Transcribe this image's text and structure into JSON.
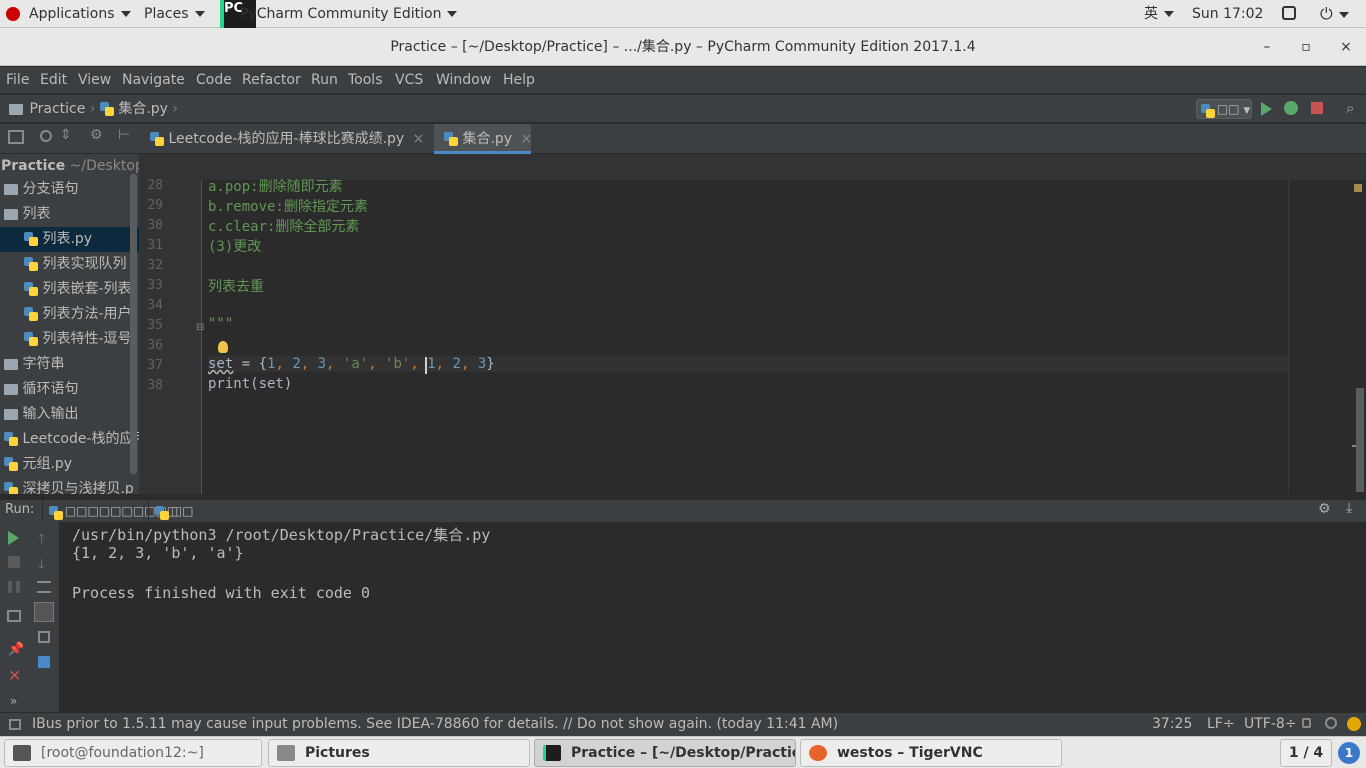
{
  "topbar": {
    "applications": "Applications",
    "places": "Places",
    "active_app": "PyCharm Community Edition",
    "input_method": "英",
    "clock": "Sun 17:02"
  },
  "window": {
    "title": "Practice – [~/Desktop/Practice] – .../集合.py – PyCharm Community Edition 2017.1.4",
    "minimize": "–",
    "maximize": "▫",
    "close": "×"
  },
  "menu": [
    "File",
    "Edit",
    "View",
    "Navigate",
    "Code",
    "Refactor",
    "Run",
    "Tools",
    "VCS",
    "Window",
    "Help"
  ],
  "nav": {
    "project": "Practice",
    "file": "集合.py",
    "run_config": "□□"
  },
  "tabs": [
    {
      "label": "Leetcode-栈的应用-棒球比赛成绩.py",
      "close": "×"
    },
    {
      "label": "集合.py",
      "close": "×"
    }
  ],
  "project_tree": {
    "root_name": "Practice",
    "root_path": "~/Desktop/",
    "items": [
      {
        "label": "分支语句",
        "type": "folder"
      },
      {
        "label": "列表",
        "type": "folder"
      },
      {
        "label": "列表.py",
        "type": "py"
      },
      {
        "label": "列表实现队列",
        "type": "py"
      },
      {
        "label": "列表嵌套-列表",
        "type": "py"
      },
      {
        "label": "列表方法-用户",
        "type": "py"
      },
      {
        "label": "列表特性-逗号",
        "type": "py"
      },
      {
        "label": "字符串",
        "type": "folder"
      },
      {
        "label": "循环语句",
        "type": "folder"
      },
      {
        "label": "输入输出",
        "type": "folder"
      },
      {
        "label": "Leetcode-栈的应用",
        "type": "py"
      },
      {
        "label": "元组.py",
        "type": "py"
      },
      {
        "label": "深拷贝与浅拷贝.p",
        "type": "py"
      }
    ]
  },
  "editor": {
    "line_numbers": [
      "28",
      "29",
      "30",
      "31",
      "32",
      "33",
      "34",
      "35",
      "36",
      "37",
      "38"
    ],
    "code": {
      "l28": "a.pop:删除随即元素",
      "l29": "b.remove:删除指定元素",
      "l30": "c.clear:删除全部元素",
      "l31": "(3)更改",
      "l33": "列表去重",
      "l35": "\"\"\"",
      "l37": {
        "name": "set",
        "op": " = {",
        "n1": "1",
        "c1": ", ",
        "n2": "2",
        "c2": ", ",
        "n3": "3",
        "c3": ", ",
        "s1": "'a'",
        "c4": ", ",
        "s2": "'b'",
        "c5": ", ",
        "n4": "1",
        "c6": ", ",
        "n5": "2",
        "c7": ", ",
        "n6": "3",
        "close": "}"
      },
      "l38": "print(set)"
    }
  },
  "run": {
    "label": "Run:",
    "config_tab": "□□□□□□□□□□",
    "second_tab": "□□",
    "console": [
      "/usr/bin/python3 /root/Desktop/Practice/集合.py",
      "{1, 2, 3, 'b', 'a'}",
      "",
      "Process finished with exit code 0"
    ]
  },
  "status": {
    "message": "IBus prior to 1.5.11 may cause input problems. See IDEA-78860 for details. // Do not show again. (today 11:41 AM)",
    "position": "37:25",
    "line_sep": "LF÷",
    "encoding": "UTF-8",
    "encoding_caret": "÷"
  },
  "taskbar": {
    "tasks": [
      "[root@foundation12:~]",
      "Pictures",
      "Practice – [~/Desktop/Practice] – ...",
      "westos – TigerVNC"
    ],
    "workspace": "1 / 4",
    "notification_count": "1"
  },
  "colors": {
    "accent": "#4a88c7",
    "run_green": "#59a869",
    "stop_red": "#c75450"
  }
}
